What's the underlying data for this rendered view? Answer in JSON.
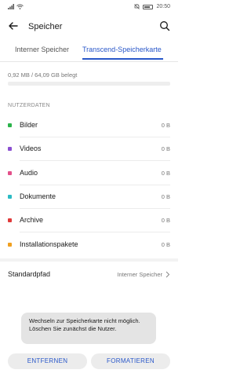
{
  "status_bar": {
    "time": "20:50",
    "battery_level": "85"
  },
  "app_bar": {
    "title": "Speicher"
  },
  "tabs": [
    {
      "label": "Interner Speicher",
      "selected": false
    },
    {
      "label": "Transcend-Speicherkarte",
      "selected": true
    }
  ],
  "usage": {
    "text": "0,92 MB / 64,09 GB belegt",
    "fraction_used": 0.0
  },
  "section": {
    "label": "NUTZERDATEN"
  },
  "categories": [
    {
      "label": "Bilder",
      "size": "0 B",
      "color": "#2bb34a"
    },
    {
      "label": "Videos",
      "size": "0 B",
      "color": "#8b4fd1"
    },
    {
      "label": "Audio",
      "size": "0 B",
      "color": "#e3508a"
    },
    {
      "label": "Dokumente",
      "size": "0 B",
      "color": "#2bbbc4"
    },
    {
      "label": "Archive",
      "size": "0 B",
      "color": "#e03a3a"
    },
    {
      "label": "Installationspakete",
      "size": "0 B",
      "color": "#f0a020"
    }
  ],
  "default_path": {
    "label": "Standardpfad",
    "value": "Interner Speicher"
  },
  "toast": {
    "text": "Wechseln zur Speicherkarte nicht möglich. Löschen Sie zunächst die Nutzer."
  },
  "buttons": {
    "remove": "ENTFERNEN",
    "format": "FORMATIEREN"
  },
  "colors": {
    "accent": "#2957c9"
  }
}
